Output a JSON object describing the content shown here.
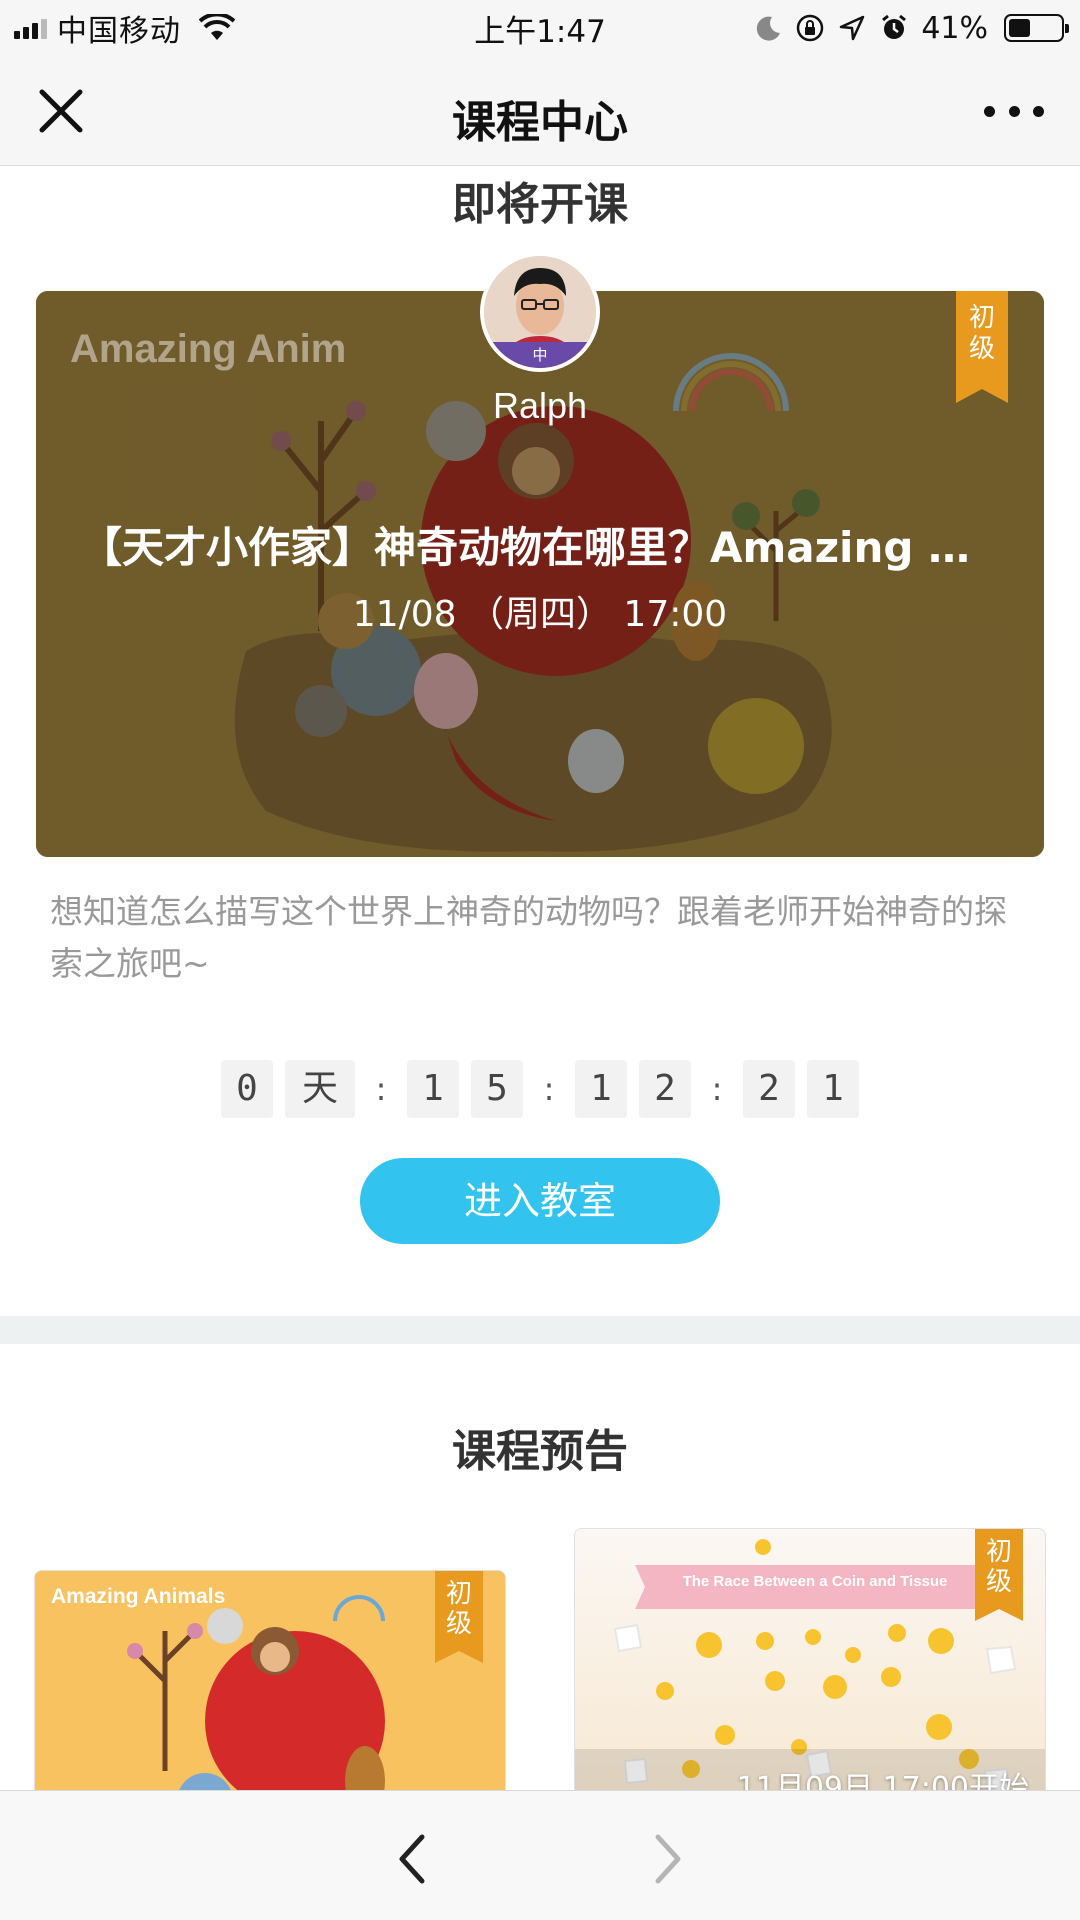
{
  "status_bar": {
    "carrier": "中国移动",
    "time": "上午1:47",
    "battery_percent": "41%",
    "battery_level": 0.41,
    "icons": [
      "signal-icon",
      "wifi-icon",
      "moon-icon",
      "rotation-lock-icon",
      "location-icon",
      "alarm-icon",
      "battery-icon"
    ]
  },
  "nav": {
    "title": "课程中心",
    "close_icon": "close-icon",
    "more_icon": "more-dots-icon"
  },
  "upcoming": {
    "heading": "即将开课",
    "hero_watermark": "Amazing Anim",
    "teacher_name": "Ralph",
    "avatar_badge": "中",
    "level_tag": "初\n级",
    "course_title": "【天才小作家】神奇动物在哪里？Amazing Animals",
    "course_time": "11/08 （周四） 17:00",
    "description": "想知道怎么描写这个世界上神奇的动物吗？跟着老师开始神奇的探索之旅吧~",
    "countdown": {
      "day_digits": [
        "0"
      ],
      "day_unit": "天",
      "separator": ":",
      "hour_digits": [
        "1",
        "5"
      ],
      "minute_digits": [
        "1",
        "2"
      ],
      "second_digits": [
        "2",
        "1"
      ]
    },
    "enter_button": "进入教室"
  },
  "preview": {
    "heading": "课程预告",
    "cards": [
      {
        "image_text": "Amazing Animals",
        "level_tag": "初\n级"
      },
      {
        "image_text": "The Race Between a Coin and Tissue",
        "level_tag": "初\n级",
        "date_overlay": "11月09日 17:00开始"
      }
    ]
  },
  "bottom_bar": {
    "back_icon": "chevron-left-icon",
    "forward_icon": "chevron-right-icon"
  },
  "colors": {
    "accent_blue": "#33c3ef",
    "tag_orange": "#e79a1d",
    "hero_bg": "#7d6530",
    "card1_bg": "#f8c260"
  }
}
